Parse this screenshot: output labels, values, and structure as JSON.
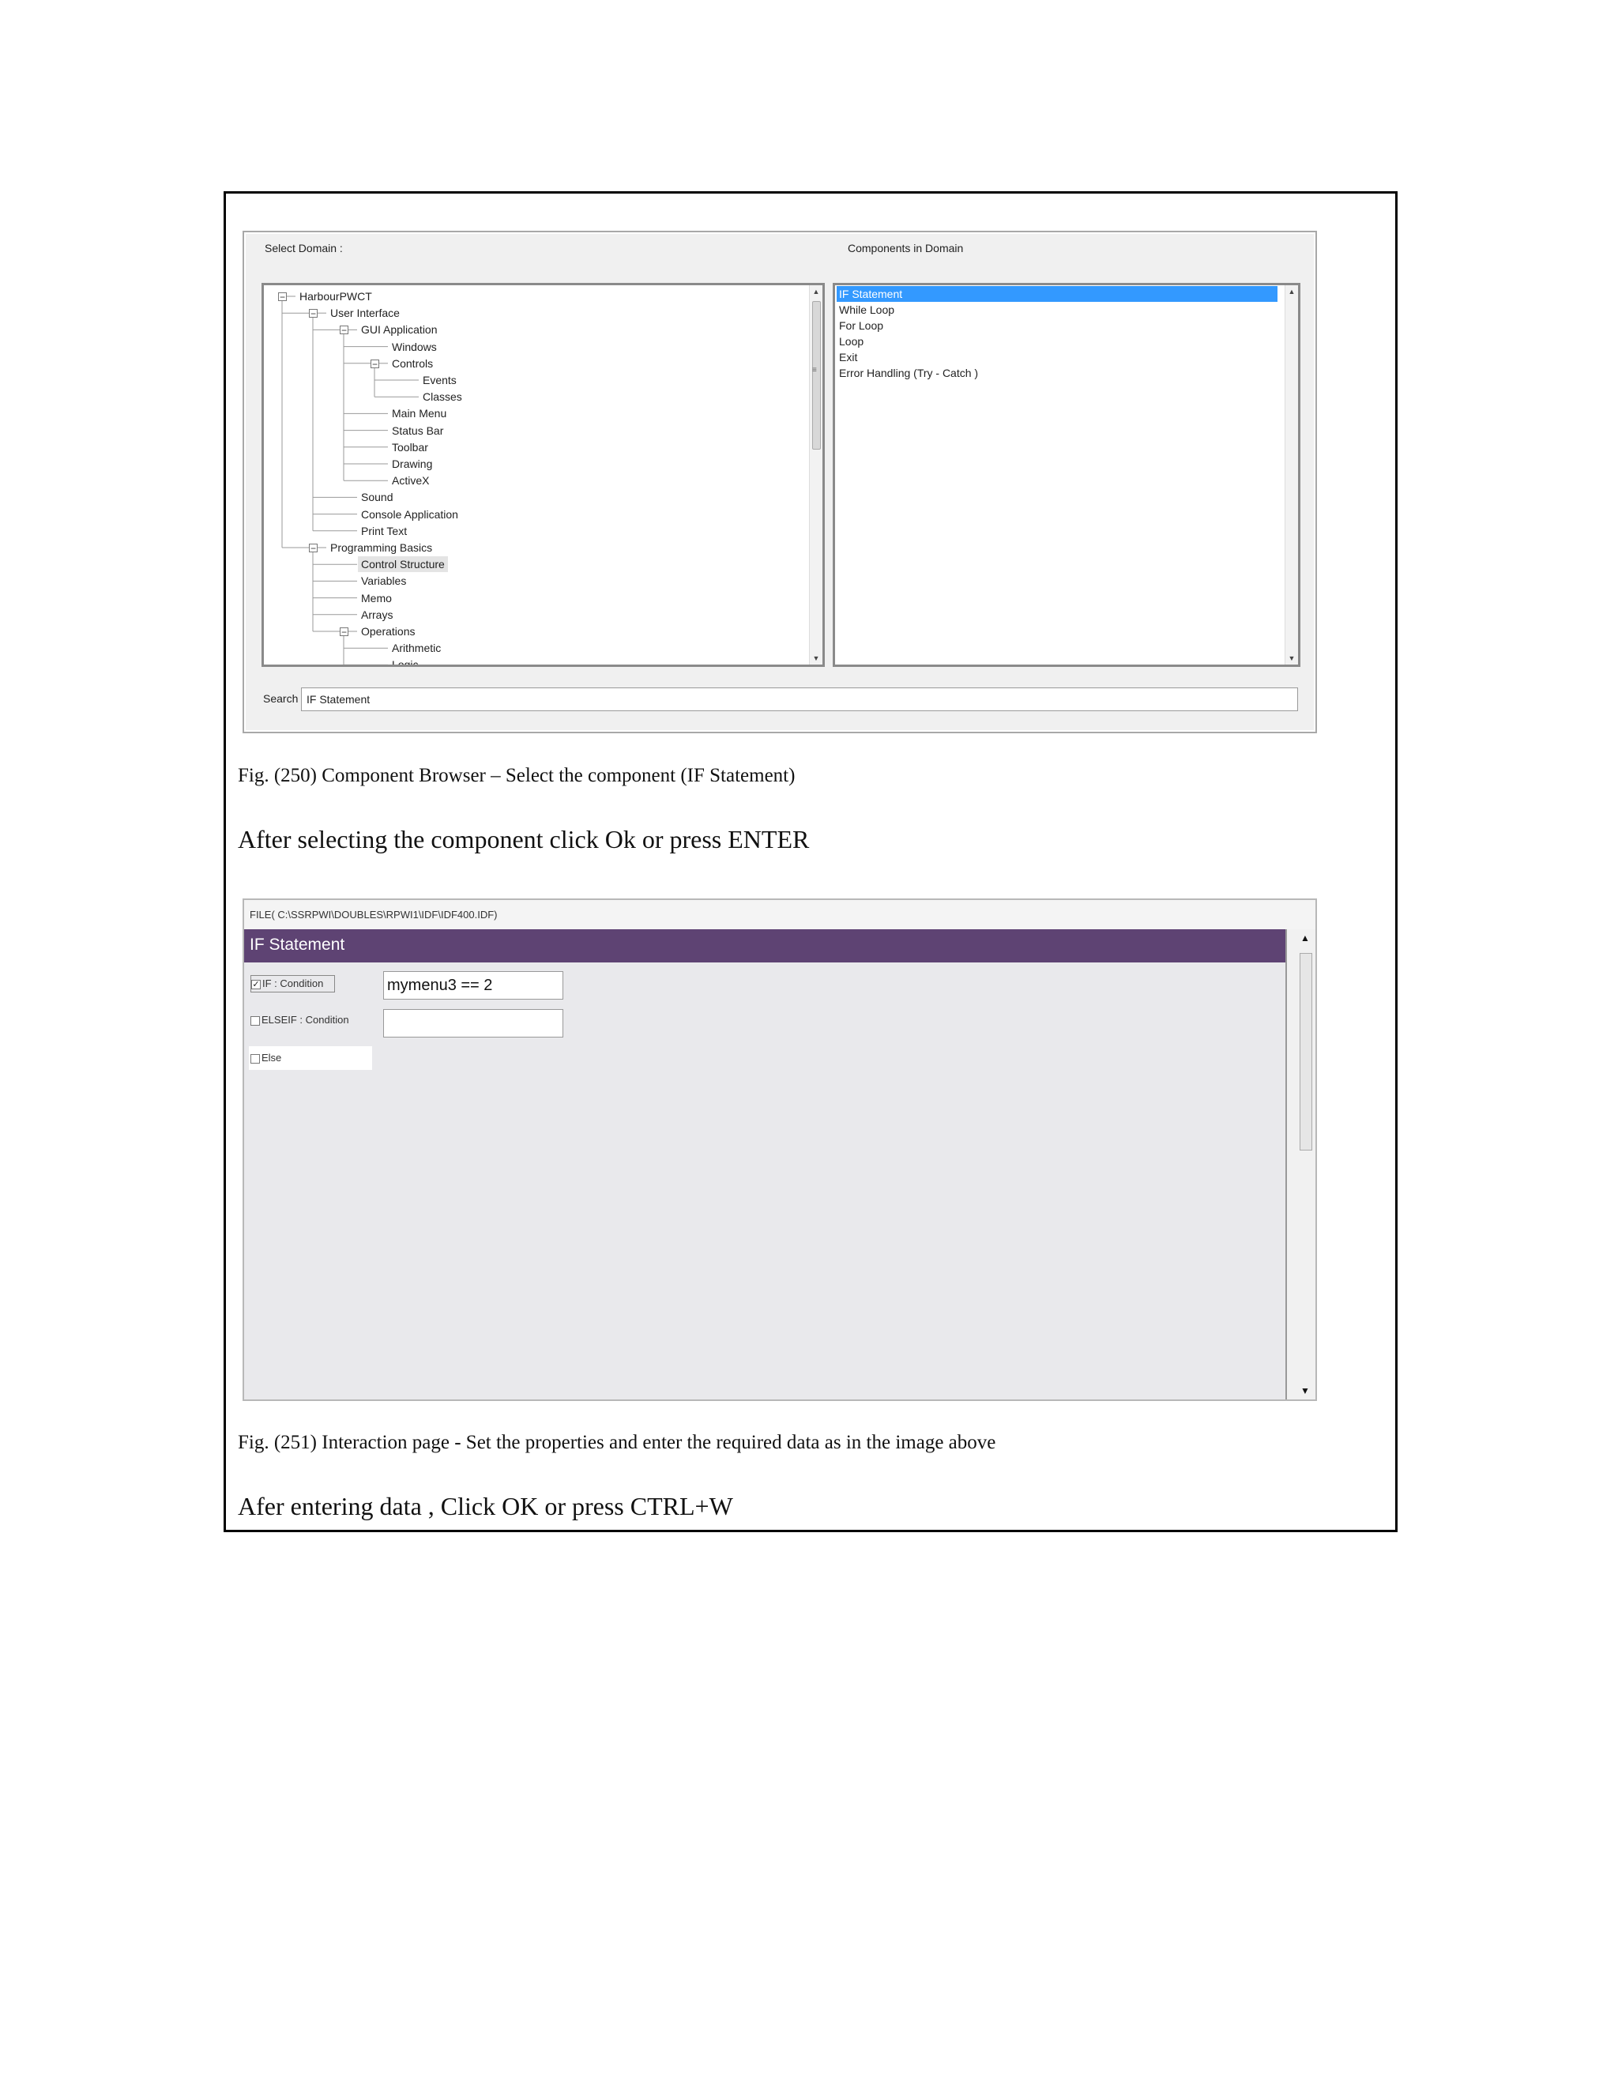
{
  "browser": {
    "select_domain_label": "Select Domain :",
    "components_label": "Components in Domain",
    "tree": [
      {
        "label": "HarbourPWCT",
        "level": 0,
        "toggle": "minus"
      },
      {
        "label": "User Interface",
        "level": 1,
        "toggle": "minus"
      },
      {
        "label": "GUI Application",
        "level": 2,
        "toggle": "minus"
      },
      {
        "label": "Windows",
        "level": 3
      },
      {
        "label": "Controls",
        "level": 3,
        "toggle": "minus"
      },
      {
        "label": "Events",
        "level": 4
      },
      {
        "label": "Classes",
        "level": 4
      },
      {
        "label": "Main Menu",
        "level": 3
      },
      {
        "label": "Status Bar",
        "level": 3
      },
      {
        "label": "Toolbar",
        "level": 3
      },
      {
        "label": "Drawing",
        "level": 3
      },
      {
        "label": "ActiveX",
        "level": 3
      },
      {
        "label": "Sound",
        "level": 2
      },
      {
        "label": "Console Application",
        "level": 2
      },
      {
        "label": "Print Text",
        "level": 2
      },
      {
        "label": "Programming Basics",
        "level": 1,
        "toggle": "minus"
      },
      {
        "label": "Control Structure",
        "level": 2,
        "selected": true
      },
      {
        "label": "Variables",
        "level": 2
      },
      {
        "label": "Memo",
        "level": 2
      },
      {
        "label": "Arrays",
        "level": 2
      },
      {
        "label": "Operations",
        "level": 2,
        "toggle": "minus"
      },
      {
        "label": "Arithmetic",
        "level": 3
      },
      {
        "label": "Logic",
        "level": 3
      }
    ],
    "components": [
      "IF Statement",
      "While Loop",
      "For Loop",
      "Loop",
      "Exit",
      "Error Handling (Try - Catch )"
    ],
    "selected_component": 0,
    "search_label": "Search",
    "search_value": "IF Statement",
    "scroll_glyph": "≡"
  },
  "captions": {
    "fig250": "Fig. (250) Component Browser – Select the component (IF Statement)",
    "instruction1": "After selecting the component click Ok or press ENTER",
    "fig251": "Fig. (251) Interaction page - Set the properties and enter the required data as in the image above",
    "instruction2": "Afer entering data , Click OK or press CTRL+W"
  },
  "interaction": {
    "file_path": "FILE( C:\\SSRPWI\\DOUBLES\\RPWI1\\IDF\\IDF400.IDF)",
    "title": "IF Statement",
    "if_label": "IF : Condition",
    "if_checked": true,
    "if_value": "mymenu3 == 2",
    "elseif_label": "ELSEIF : Condition",
    "elseif_checked": false,
    "elseif_value": "",
    "else_label": "Else",
    "else_checked": false
  },
  "colors": {
    "title_bar": "#5e4373",
    "selection": "#3399ff"
  }
}
